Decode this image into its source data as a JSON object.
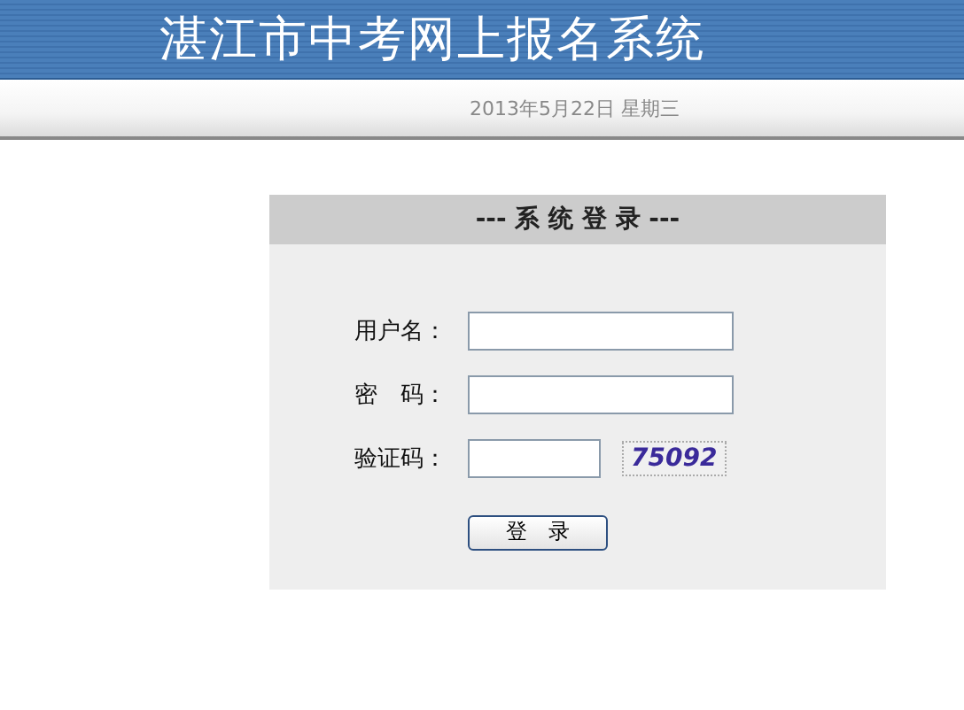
{
  "header": {
    "title": "湛江市中考网上报名系统",
    "date": "2013年5月22日  星期三"
  },
  "login": {
    "title": "--- 系 统 登 录 ---",
    "fields": [
      {
        "kind": "text",
        "label": "用户名："
      },
      {
        "kind": "password",
        "label": "密　码："
      },
      {
        "kind": "captcha",
        "label": "验证码：",
        "captcha": "75092"
      }
    ],
    "button": "登　录"
  }
}
